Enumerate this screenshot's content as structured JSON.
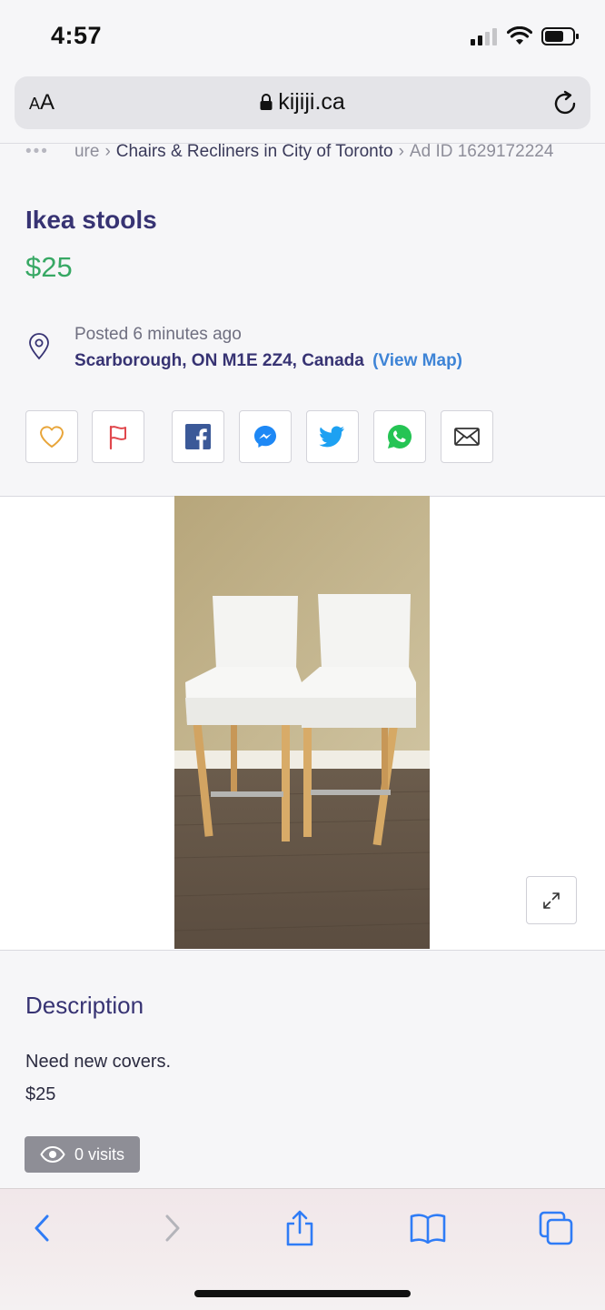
{
  "status": {
    "time": "4:57"
  },
  "browser": {
    "text_size_label_small": "A",
    "text_size_label_big": "A",
    "url": "kijiji.ca"
  },
  "breadcrumb": {
    "dots": "•••",
    "partial": "ure",
    "category": "Chairs & Recliners in City of Toronto",
    "ad_id": "Ad ID 1629172224"
  },
  "listing": {
    "title": "Ikea stools",
    "price": "$25",
    "posted": "Posted 6 minutes ago",
    "address": "Scarborough, ON M1E 2Z4, Canada",
    "view_map": "(View Map)"
  },
  "actions": [
    "heart-icon",
    "flag-icon",
    "facebook-icon",
    "messenger-icon",
    "twitter-icon",
    "whatsapp-icon",
    "email-icon"
  ],
  "description": {
    "heading": "Description",
    "lines": [
      "Need new covers.",
      "$25"
    ],
    "visits": "0 visits"
  },
  "colors": {
    "price": "#37a864",
    "link": "#3e84d6",
    "accent": "#373373",
    "ios_blue": "#2f7cf6"
  }
}
